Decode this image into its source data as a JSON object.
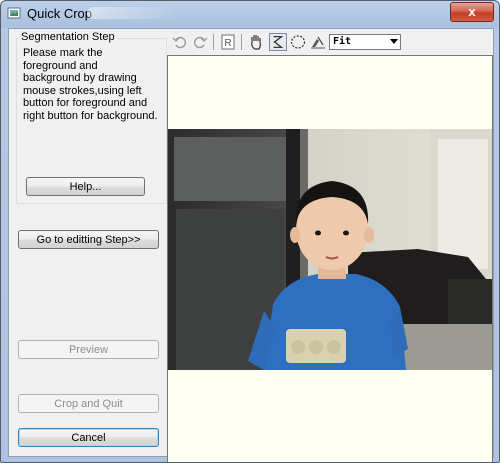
{
  "window": {
    "title": "Quick Crop",
    "close_label": "x"
  },
  "left_panel": {
    "group_title": "Segmentation Step",
    "instructions": "Please mark the foreground and background by drawing mouse strokes,using left button for foreground and right button for background.",
    "help_button": "Help...",
    "editing_button": "Go to editting Step>>",
    "preview_button": "Preview",
    "crop_button": "Crop and Quit",
    "cancel_button": "Cancel"
  },
  "toolbar": {
    "zoom_value": "Fit",
    "icons": [
      "undo-icon",
      "redo-icon",
      "reset-icon",
      "hand-icon",
      "stroke-brush-icon",
      "lasso-ellipse-icon",
      "eraser-icon"
    ],
    "active_tool": "stroke-brush-icon"
  },
  "canvas": {
    "background": "#fffff2"
  },
  "colors": {
    "close": "#c24028",
    "default_border": "#3c7fb1"
  }
}
